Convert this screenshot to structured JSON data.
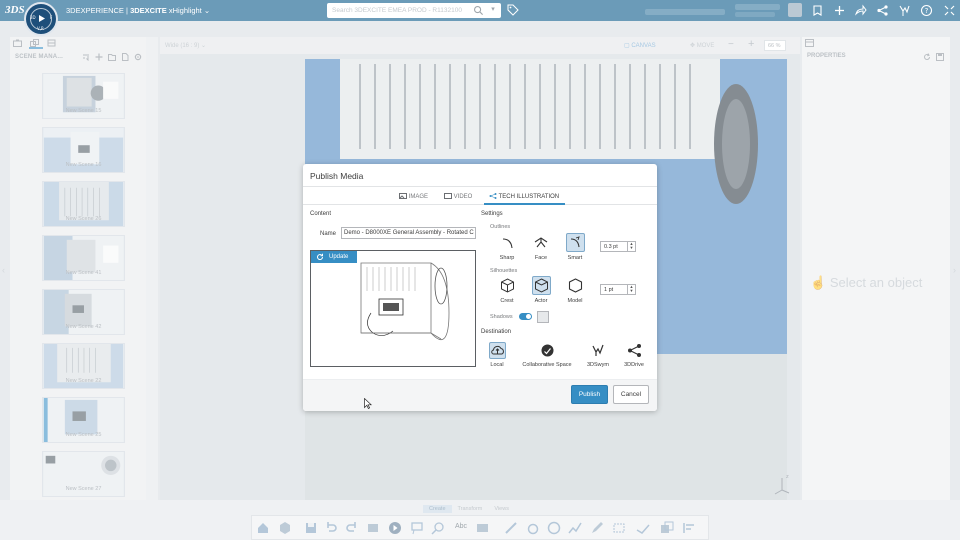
{
  "topbar": {
    "logo": "3DS",
    "compass_labels": [
      "3D",
      "V,R",
      "F"
    ],
    "app_title_prefix": "3DEXPERIENCE | ",
    "app_title_brand": "3DEXCITE",
    "app_title_suffix": " xHighlight",
    "search_placeholder": "Search 3DEXCITE EMEA PROD - R1132100",
    "icons": [
      "tag-icon",
      "bookmark-icon",
      "plus-icon",
      "share-icon",
      "network-icon",
      "compass-icon",
      "help-icon",
      "collapse-icon"
    ]
  },
  "left_panel": {
    "title": "SCENE MANA...",
    "scenes": [
      {
        "label": "New Scene 15"
      },
      {
        "label": "New Scene 16"
      },
      {
        "label": "New Scene 26"
      },
      {
        "label": "New Scene 41"
      },
      {
        "label": "New Scene 42"
      },
      {
        "label": "New Scene 22"
      },
      {
        "label": "New Scene 25"
      },
      {
        "label": "New Scene 27"
      }
    ]
  },
  "viewport_toolbar": {
    "aspect": "Wide (16 : 9)",
    "canvas": "CANVAS",
    "move": "MOVE",
    "zoom": "66 %"
  },
  "right_panel": {
    "title": "PROPERTIES",
    "placeholder": "Select an object"
  },
  "bottom": {
    "tabs": [
      "Create",
      "Transform",
      "Views"
    ],
    "active_tab": "Create",
    "text_tool": "Abc"
  },
  "dialog": {
    "title": "Publish Media",
    "tabs": [
      {
        "label": "IMAGE",
        "icon": "image-icon"
      },
      {
        "label": "VIDEO",
        "icon": "video-icon"
      },
      {
        "label": "TECH ILLUSTRATION",
        "icon": "tech-illustration-icon"
      }
    ],
    "active_tab": "TECH ILLUSTRATION",
    "content_label": "Content",
    "name_label": "Name",
    "name_value": "Demo - D8000XE General Assembly - Rotated C",
    "update_label": "Update",
    "settings_label": "Settings",
    "outlines_label": "Outlines",
    "outlines": [
      {
        "label": "Sharp",
        "selected": false
      },
      {
        "label": "Face",
        "selected": false
      },
      {
        "label": "Smart",
        "selected": true
      }
    ],
    "outline_width": "0.3 pt",
    "silhouettes_label": "Silhouettes",
    "silhouettes": [
      {
        "label": "Crest",
        "selected": false
      },
      {
        "label": "Actor",
        "selected": true
      },
      {
        "label": "Model",
        "selected": false
      }
    ],
    "silhouette_width": "1 pt",
    "shadows_label": "Shadows",
    "shadows_on": true,
    "destination_label": "Destination",
    "destinations": [
      {
        "label": "Local",
        "selected": true
      },
      {
        "label": "Collaborative Space",
        "selected": false
      },
      {
        "label": "3DSwym",
        "selected": false
      },
      {
        "label": "3DDrive",
        "selected": false
      }
    ],
    "publish_label": "Publish",
    "cancel_label": "Cancel"
  },
  "colors": {
    "topbar": "#005386",
    "accent": "#368ec4",
    "model_blue": "#4a86c0"
  }
}
